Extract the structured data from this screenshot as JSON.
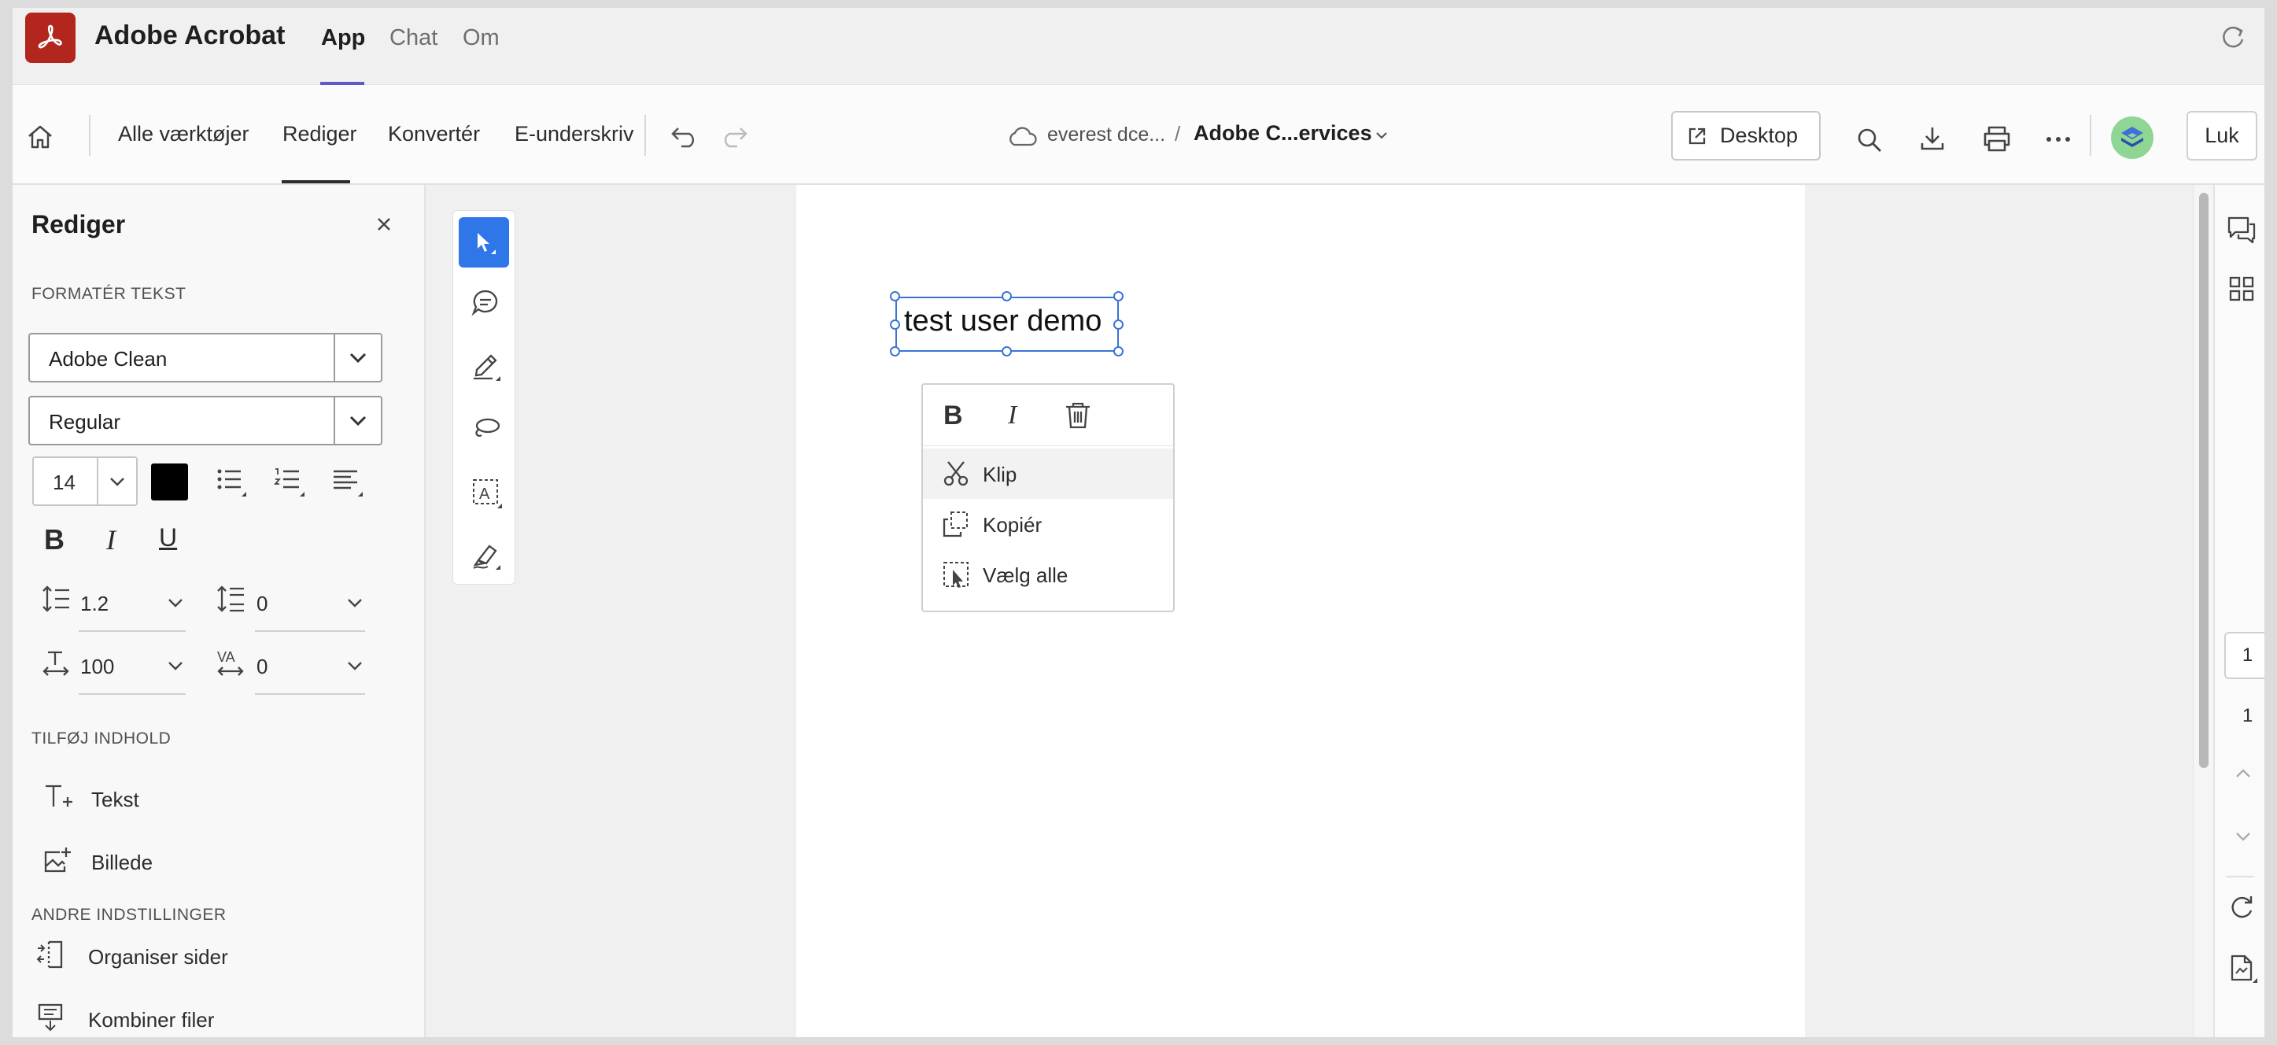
{
  "app": {
    "name": "Adobe Acrobat",
    "tabs": [
      "App",
      "Chat",
      "Om"
    ]
  },
  "toolbar": {
    "nav": [
      "Alle værktøjer",
      "Rediger",
      "Konvertér",
      "E-underskriv"
    ],
    "breadcrumb_storage": "everest dce...",
    "breadcrumb_separator": "/",
    "document_name": "Adobe C...ervices",
    "desktop_label": "Desktop",
    "close_label": "Luk"
  },
  "panel": {
    "title": "Rediger",
    "format_section": "FORMATÉR TEKST",
    "font_family": "Adobe Clean",
    "font_style": "Regular",
    "font_size": "14",
    "text_color": "#000000",
    "bold": "B",
    "italic": "I",
    "underline": "U",
    "line_spacing": "1.2",
    "paragraph_spacing": "0",
    "horizontal_scale": "100",
    "char_spacing": "0",
    "add_section": "TILFØJ INDHOLD",
    "add_items": [
      "Tekst",
      "Billede"
    ],
    "other_section": "ANDRE INDSTILLINGER",
    "other_items": [
      "Organiser sider",
      "Kombiner filer"
    ]
  },
  "document": {
    "selected_text": "test user demo"
  },
  "context_menu": {
    "bold": "B",
    "italic": "I",
    "cut": "Klip",
    "copy": "Kopiér",
    "select_all": "Vælg alle"
  },
  "pager": {
    "current": "1",
    "total": "1"
  },
  "colors": {
    "brand": "#b3261e",
    "accent": "#2f76e9",
    "tab_indicator": "#5c5cc8"
  }
}
